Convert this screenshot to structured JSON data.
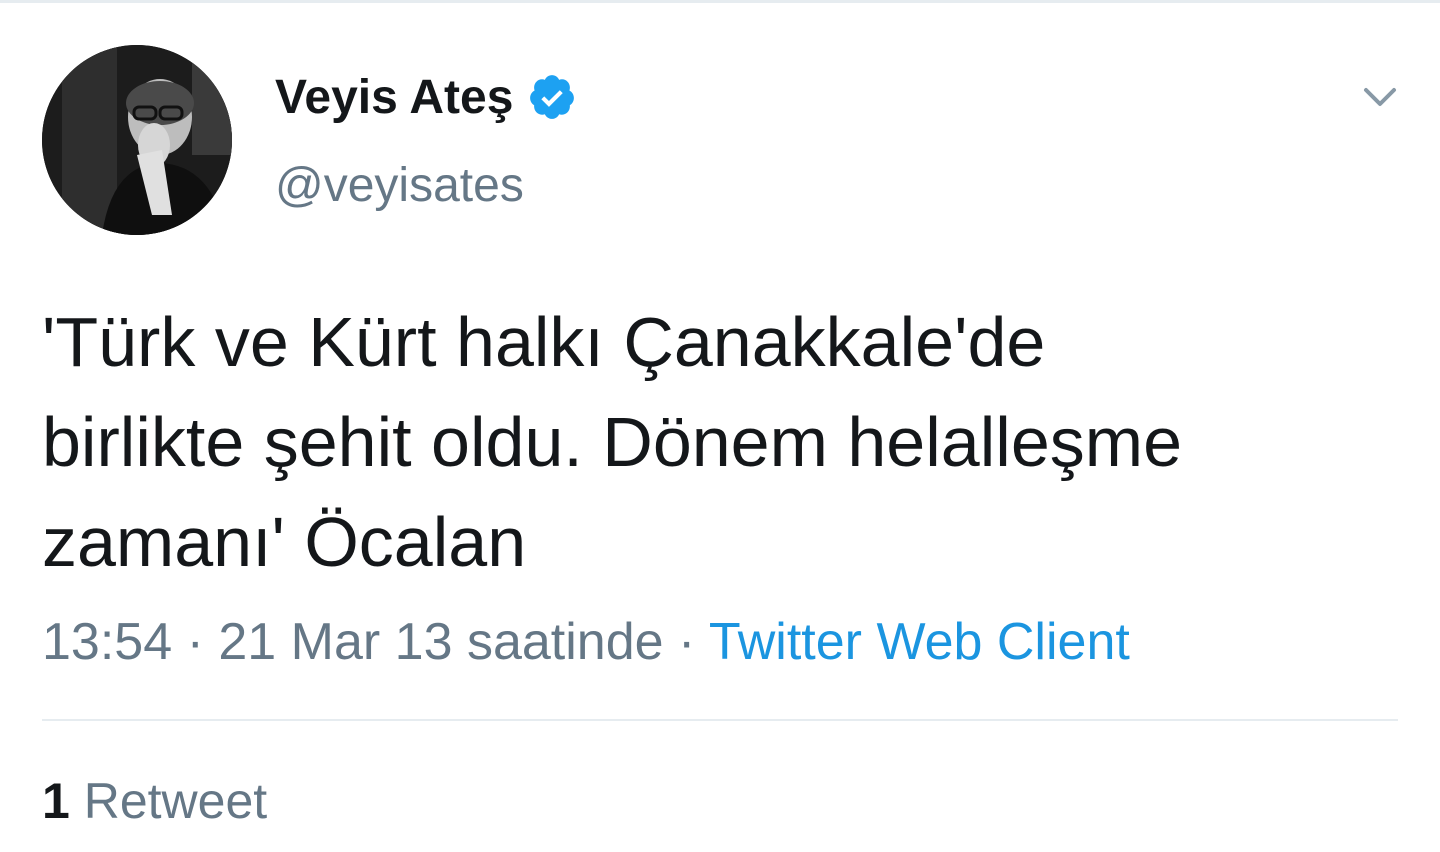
{
  "tweet": {
    "author": {
      "name": "Veyis Ateş",
      "handle": "@veyisates",
      "verified": true,
      "avatar_icon": "profile-photo-grayscale"
    },
    "text_lines": [
      "'Türk ve Kürt halkı Çanakkale'de",
      "birlikte şehit oldu. Dönem helalleşme",
      "zamanı' Öcalan"
    ],
    "time": "13:54",
    "separator": "·",
    "date_label": "21 Mar 13 saatinde",
    "source": "Twitter Web Client",
    "retweet_count": "1",
    "retweet_label": "Retweet"
  },
  "colors": {
    "text_primary": "#14171a",
    "text_secondary": "#657786",
    "link_blue": "#1b95e0",
    "verified_blue": "#1da1f2",
    "divider": "#e6ecf0"
  },
  "icons": {
    "verified": "verified-badge-icon",
    "menu": "chevron-down-icon"
  }
}
